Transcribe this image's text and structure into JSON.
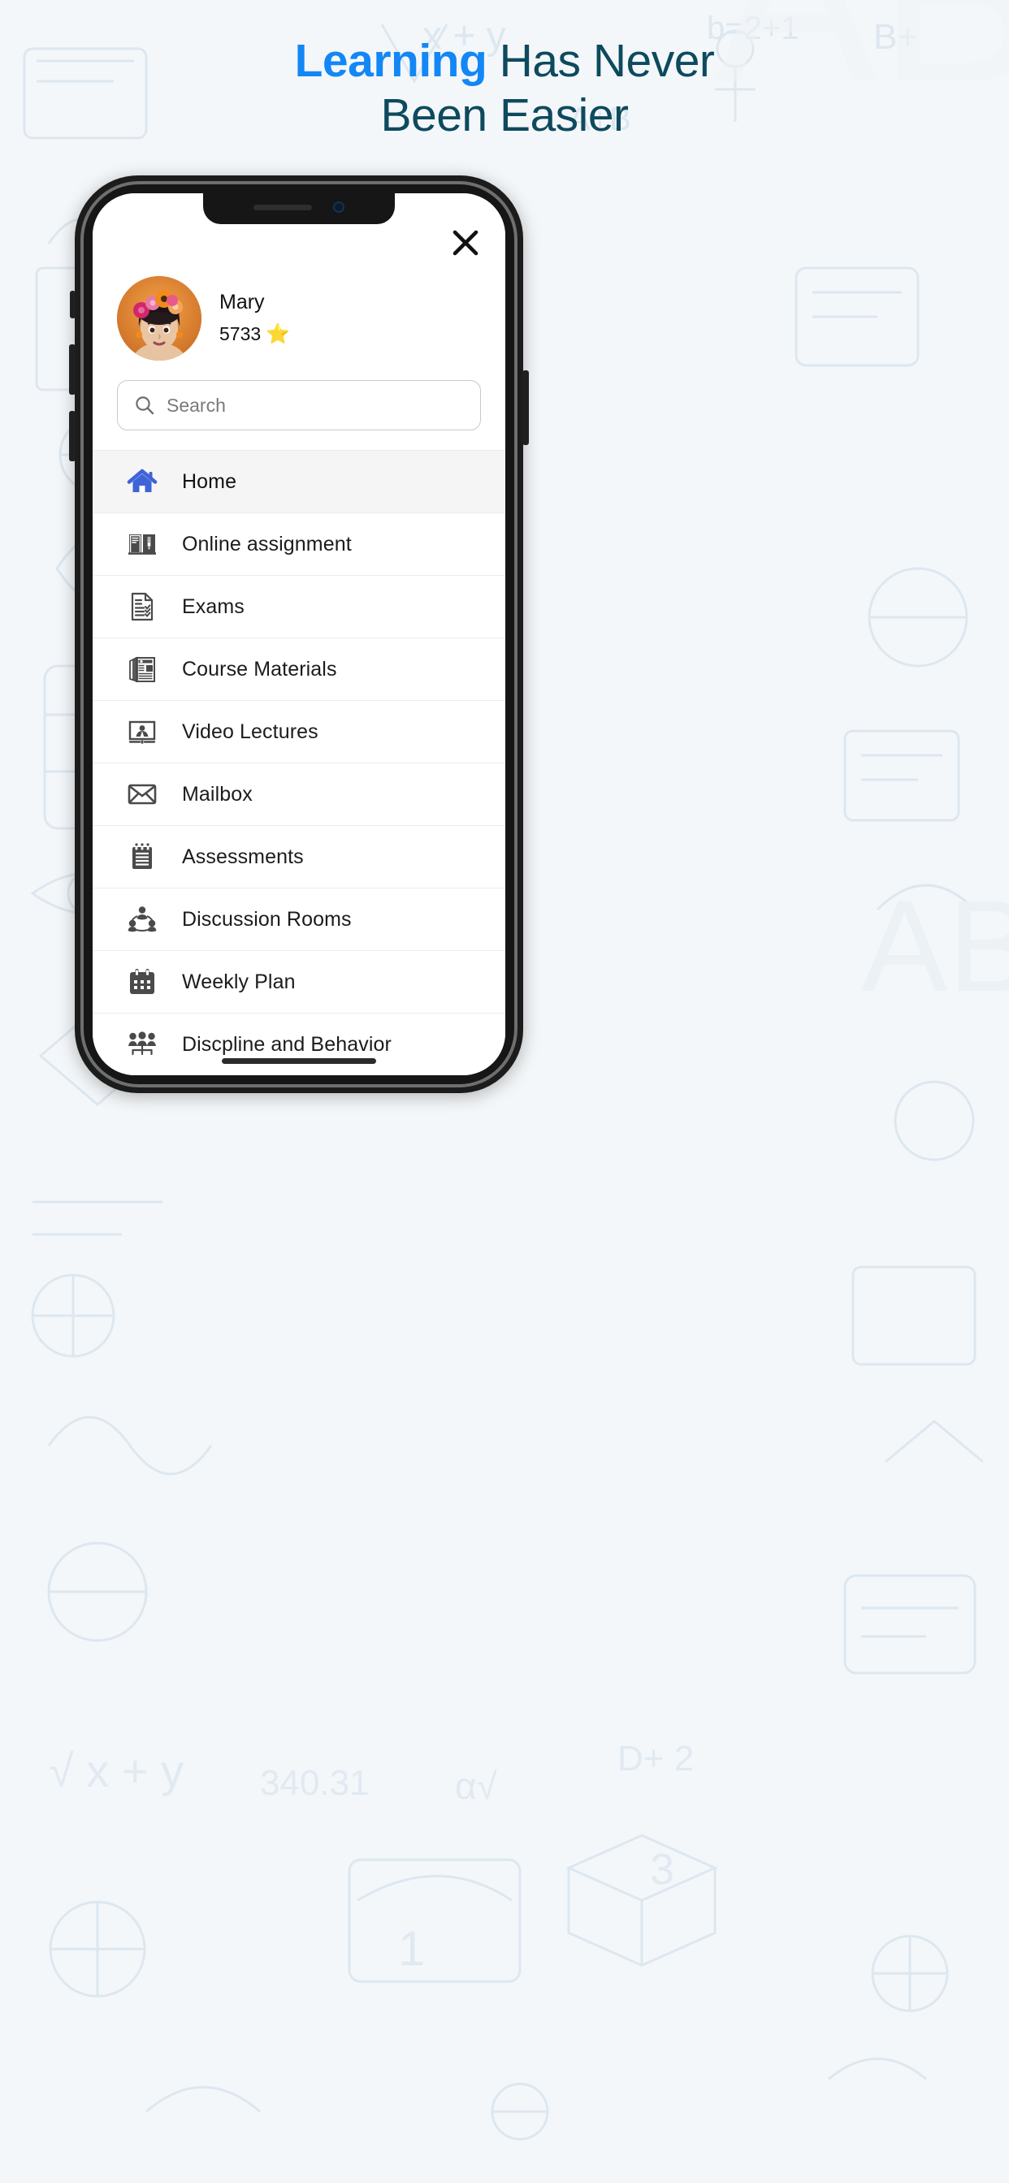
{
  "headline": {
    "line1_highlight": "Learning",
    "line1_rest": " Has Never",
    "line2": "Been Easier",
    "highlight_color": "#1387f5",
    "text_color": "#0d4a5e"
  },
  "phone": {
    "close_icon": "close-icon",
    "status": {
      "speaker": "speaker-grille",
      "camera": "front-camera"
    }
  },
  "profile": {
    "avatar_alt": "girl-with-flower-crown-avatar",
    "name": "Mary",
    "points": "5733",
    "points_icon": "star-icon"
  },
  "search": {
    "placeholder": "Search",
    "value": "",
    "icon": "search-icon"
  },
  "menu": {
    "active_index": 0,
    "active_color": "#3f63d8",
    "icon_color": "#4a4a4a",
    "items": [
      {
        "label": "Home",
        "icon": "home-icon"
      },
      {
        "label": "Online assignment",
        "icon": "book-pencil-icon"
      },
      {
        "label": "Exams",
        "icon": "checklist-document-icon"
      },
      {
        "label": "Course Materials",
        "icon": "newspaper-icon"
      },
      {
        "label": "Video Lectures",
        "icon": "presenter-screen-icon"
      },
      {
        "label": "Mailbox",
        "icon": "envelope-icon"
      },
      {
        "label": "Assessments",
        "icon": "notepad-icon"
      },
      {
        "label": "Discussion Rooms",
        "icon": "people-group-circle-icon"
      },
      {
        "label": "Weekly Plan",
        "icon": "calendar-icon"
      },
      {
        "label": "Discpline and Behavior",
        "icon": "people-hierarchy-icon"
      }
    ]
  }
}
